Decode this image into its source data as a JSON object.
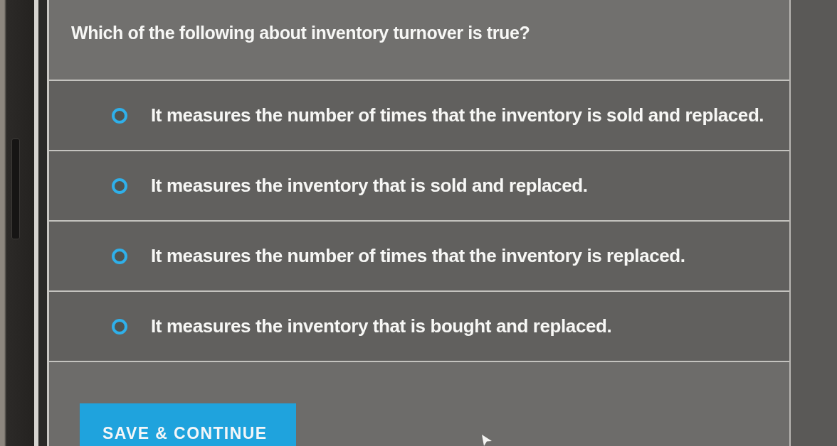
{
  "question": "Which of the following about inventory turnover is true?",
  "options": [
    {
      "label": "It measures the number of times that the inventory is sold and replaced.",
      "selected": false
    },
    {
      "label": "It measures the inventory that is sold and replaced.",
      "selected": false
    },
    {
      "label": "It measures the number of times that the inventory is replaced.",
      "selected": false
    },
    {
      "label": "It measures the inventory that is bought and replaced.",
      "selected": false
    }
  ],
  "button": {
    "label": "SAVE & CONTINUE"
  }
}
